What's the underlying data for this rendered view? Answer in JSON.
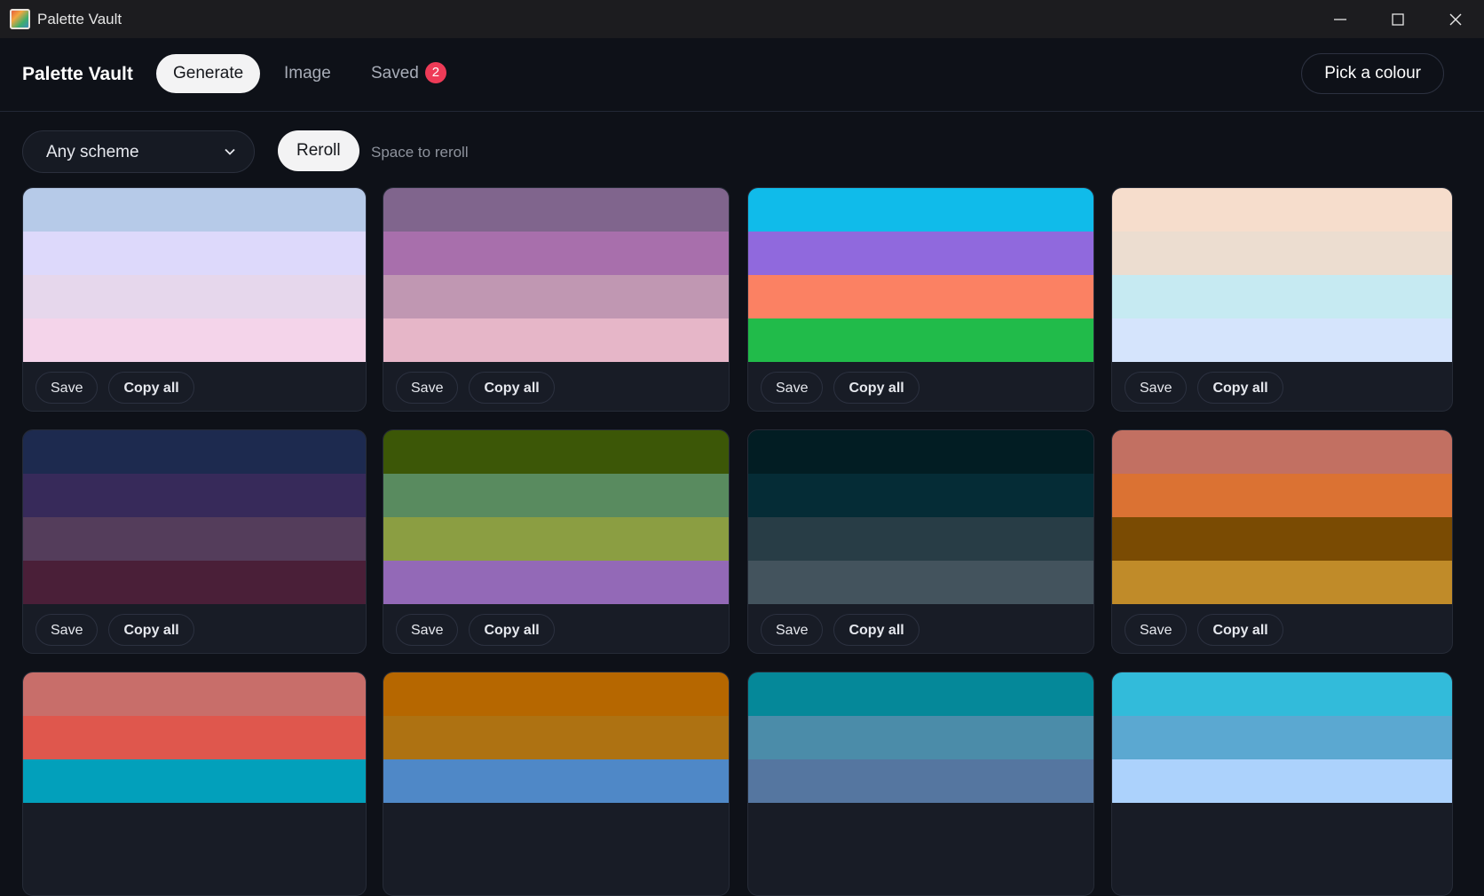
{
  "window": {
    "title": "Palette Vault"
  },
  "header": {
    "brand": "Palette Vault",
    "tabs": [
      {
        "label": "Generate",
        "active": true
      },
      {
        "label": "Image",
        "active": false
      },
      {
        "label": "Saved",
        "active": false,
        "badge": "2"
      }
    ],
    "pick_button": "Pick a colour"
  },
  "controls": {
    "scheme_select": "Any scheme",
    "reroll_button": "Reroll",
    "hint": "Space to reroll"
  },
  "card_actions": {
    "save": "Save",
    "copy_all": "Copy all"
  },
  "palettes": [
    [
      "#b6cae8",
      "#ddd9fb",
      "#e6d7ec",
      "#f4d4ea"
    ],
    [
      "#80658d",
      "#a86fac",
      "#c097b2",
      "#e6b6c8"
    ],
    [
      "#10bbea",
      "#9069dd",
      "#fb8163",
      "#21bb4a"
    ],
    [
      "#f6ddcc",
      "#ecddd0",
      "#c6eaf2",
      "#d5e4fc"
    ],
    [
      "#1d2a4f",
      "#372a5a",
      "#543d5b",
      "#4a1f38"
    ],
    [
      "#3c5707",
      "#598b5f",
      "#8b9e42",
      "#9369b7"
    ],
    [
      "#021d23",
      "#052c36",
      "#283d46",
      "#43535d"
    ],
    [
      "#c27062",
      "#db7233",
      "#7a4b03",
      "#c08b29"
    ],
    [
      "#c86e6a",
      "#df574d",
      "#02a0bb"
    ],
    [
      "#b66700",
      "#ae7212",
      "#4f88c7"
    ],
    [
      "#058899",
      "#4b8ca9",
      "#5576a0"
    ],
    [
      "#32bbda",
      "#5ba8d1",
      "#acd2fc"
    ]
  ]
}
